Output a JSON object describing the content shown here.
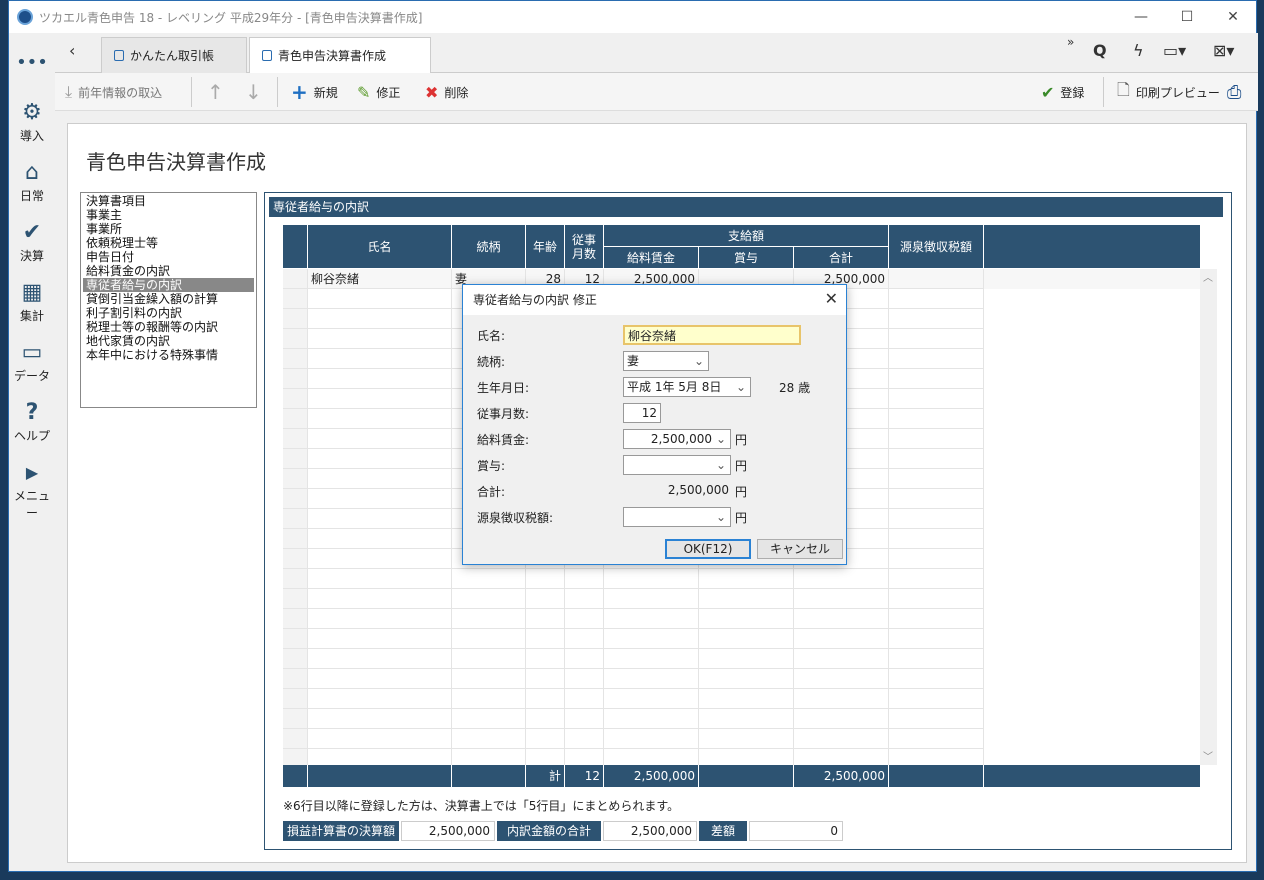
{
  "window": {
    "title": "ツカエル青色申告 18 - レベリング 平成29年分 - [青色申告決算書作成]"
  },
  "sidebar": {
    "items": [
      {
        "label": "",
        "icon": "more-icon"
      },
      {
        "label": "導入",
        "icon": "gear-icon"
      },
      {
        "label": "日常",
        "icon": "home-icon"
      },
      {
        "label": "決算",
        "icon": "check-icon"
      },
      {
        "label": "集計",
        "icon": "calculator-icon"
      },
      {
        "label": "データ",
        "icon": "folder-icon"
      },
      {
        "label": "ヘルプ",
        "icon": "question-icon"
      },
      {
        "label": "メニュー",
        "icon": "play-icon"
      }
    ]
  },
  "tabs": [
    {
      "label": "かんたん取引帳"
    },
    {
      "label": "青色申告決算書作成"
    }
  ],
  "toolbar": {
    "import_prev": "前年情報の取込",
    "new": "新規",
    "edit": "修正",
    "delete": "削除",
    "register": "登録",
    "print_preview": "印刷プレビュー"
  },
  "page": {
    "title": "青色申告決算書作成"
  },
  "left_list": [
    "決算書項目",
    "事業主",
    "事業所",
    "依頼税理士等",
    "申告日付",
    "給料賃金の内訳",
    "専従者給与の内訳",
    "貸倒引当金繰入額の計算",
    "利子割引料の内訳",
    "税理士等の報酬等の内訳",
    "地代家賃の内訳",
    "本年中における特殊事情"
  ],
  "panel": {
    "header": "専従者給与の内訳",
    "columns": {
      "name": "氏名",
      "relation": "続柄",
      "age": "年齢",
      "months": "従事月数",
      "payment": "支給額",
      "salary": "給料賃金",
      "bonus": "賞与",
      "total": "合計",
      "withholding": "源泉徴収税額"
    },
    "rows": [
      {
        "name": "柳谷奈緒",
        "relation": "妻",
        "age": "28",
        "months": "12",
        "salary": "2,500,000",
        "bonus": "",
        "total": "2,500,000",
        "withholding": ""
      }
    ],
    "footer": {
      "label": "計",
      "months": "12",
      "salary": "2,500,000",
      "total": "2,500,000"
    },
    "note": "※6行目以降に登録した方は、決算書上では「5行目」にまとめられます。",
    "summary": {
      "pl_label": "損益計算書の決算額",
      "pl_value": "2,500,000",
      "detail_label": "内訳金額の合計",
      "detail_value": "2,500,000",
      "diff_label": "差額",
      "diff_value": "0"
    }
  },
  "dialog": {
    "title": "専従者給与の内訳 修正",
    "name_label": "氏名:",
    "name_value": "柳谷奈緒",
    "relation_label": "続柄:",
    "relation_value": "妻",
    "birth_label": "生年月日:",
    "birth_value": "平成 1年 5月 8日",
    "age_text": "28 歳",
    "months_label": "従事月数:",
    "months_value": "12",
    "salary_label": "給料賃金:",
    "salary_value": "2,500,000",
    "bonus_label": "賞与:",
    "bonus_value": "",
    "total_label": "合計:",
    "total_value": "2,500,000",
    "withholding_label": "源泉徴収税額:",
    "withholding_value": "",
    "unit": "円",
    "ok": "OK(F12)",
    "cancel": "キャンセル"
  }
}
